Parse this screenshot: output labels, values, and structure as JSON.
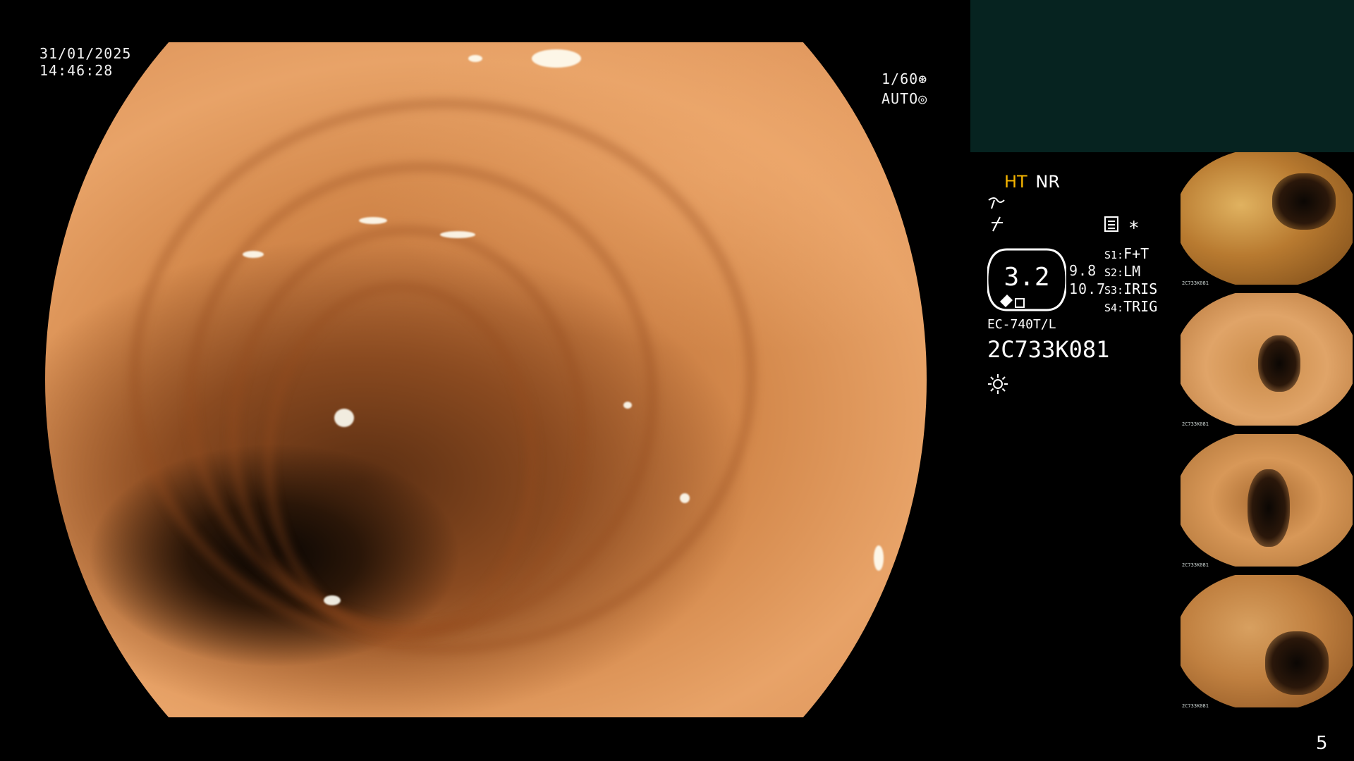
{
  "osd": {
    "date": "31/01/2025",
    "time": "14:46:28",
    "shutter": "1/60",
    "iris_mode": "AUTO"
  },
  "modes": {
    "ht_label": "HT",
    "nr_label": "NR",
    "accent_color": "#f5b400"
  },
  "gauge": {
    "value": "3.2",
    "reading_top": "9.8",
    "reading_bottom": "10.7"
  },
  "switches": [
    {
      "key": "S1:",
      "value": "F+T"
    },
    {
      "key": "S2:",
      "value": "LM"
    },
    {
      "key": "S3:",
      "value": "IRIS"
    },
    {
      "key": "S4:",
      "value": "TRIG"
    }
  ],
  "scope": {
    "model": "EC-740T/L",
    "serial": "2C733K081"
  },
  "icons": {
    "shutter": "shutter-aperture-icon",
    "iris": "iris-ring-icon",
    "structure": "structure-enhance-icon",
    "color": "color-enhance-icon",
    "memory": "memory-card-icon",
    "asterisk": "asterisk-icon",
    "light": "light-sun-icon"
  },
  "thumbnails": [
    {
      "caption_serial": "2C733K081"
    },
    {
      "caption_serial": "2C733K081"
    },
    {
      "caption_serial": "2C733K081"
    },
    {
      "caption_serial": "2C733K081"
    }
  ],
  "page_number": "5"
}
